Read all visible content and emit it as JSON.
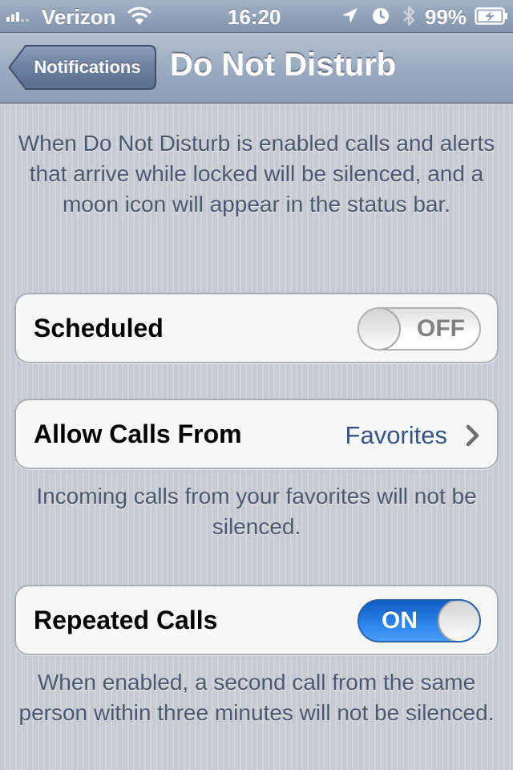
{
  "status_bar": {
    "carrier": "Verizon",
    "time": "16:20",
    "battery_percent": "99%",
    "signal_bars": 3,
    "icons": [
      "signal-icon",
      "wifi-icon",
      "location-arrow-icon",
      "alarm-clock-icon",
      "bluetooth-icon",
      "battery-charging-icon"
    ]
  },
  "nav": {
    "back_label": "Notifications",
    "title": "Do Not Disturb"
  },
  "intro": {
    "text": "When Do Not Disturb is enabled calls and alerts that arrive while locked will be silenced, and a moon icon will appear in the status bar."
  },
  "scheduled": {
    "label": "Scheduled",
    "state": "OFF"
  },
  "allow_calls": {
    "label": "Allow Calls From",
    "value": "Favorites",
    "footer": "Incoming calls from your favorites will not be silenced."
  },
  "repeated_calls": {
    "label": "Repeated Calls",
    "state": "ON",
    "footer": "When enabled, a second call from the same person within three minutes will not be silenced."
  },
  "colors": {
    "switch_on": "#2d86ee",
    "value_text": "#385487",
    "footer_text": "#4c566c"
  }
}
